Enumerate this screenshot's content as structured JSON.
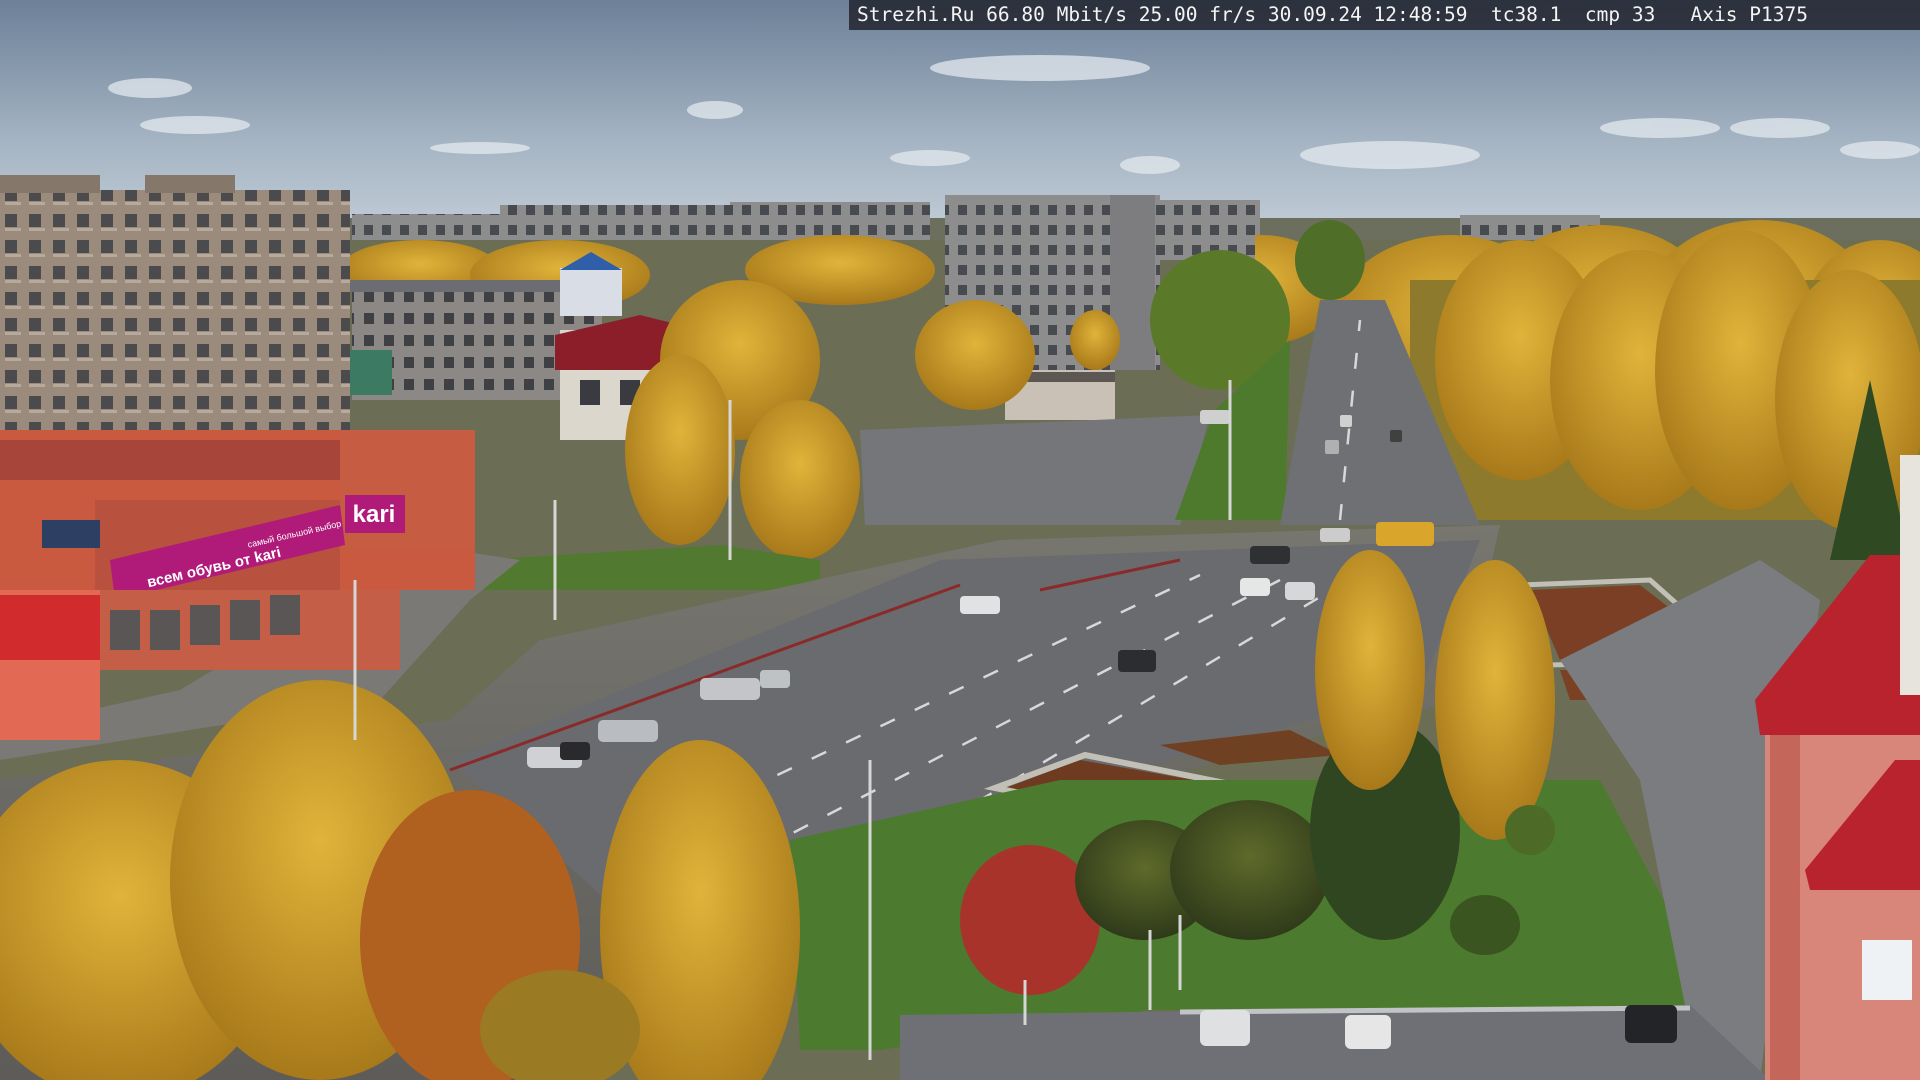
{
  "camera_osd": {
    "text": "Strezhi.Ru 66.80 Mbit/s 25.00 fr/s 30.09.24 12:48:59  tc38.1  cmp 33   Axis P1375"
  },
  "store_signs": {
    "kari_logo": "kari",
    "kari_slogan": "всем обувь от kari",
    "kari_sub": "самый большой выбор"
  },
  "colors": {
    "sky_top": "#6f8399",
    "sky_bottom": "#b5c3cf",
    "foliage_gold": "#c99a1e",
    "grass": "#4f7a2c",
    "asphalt": "#6e6e70",
    "kari_magenta": "#b01b7a",
    "roof_red": "#b8232e"
  }
}
